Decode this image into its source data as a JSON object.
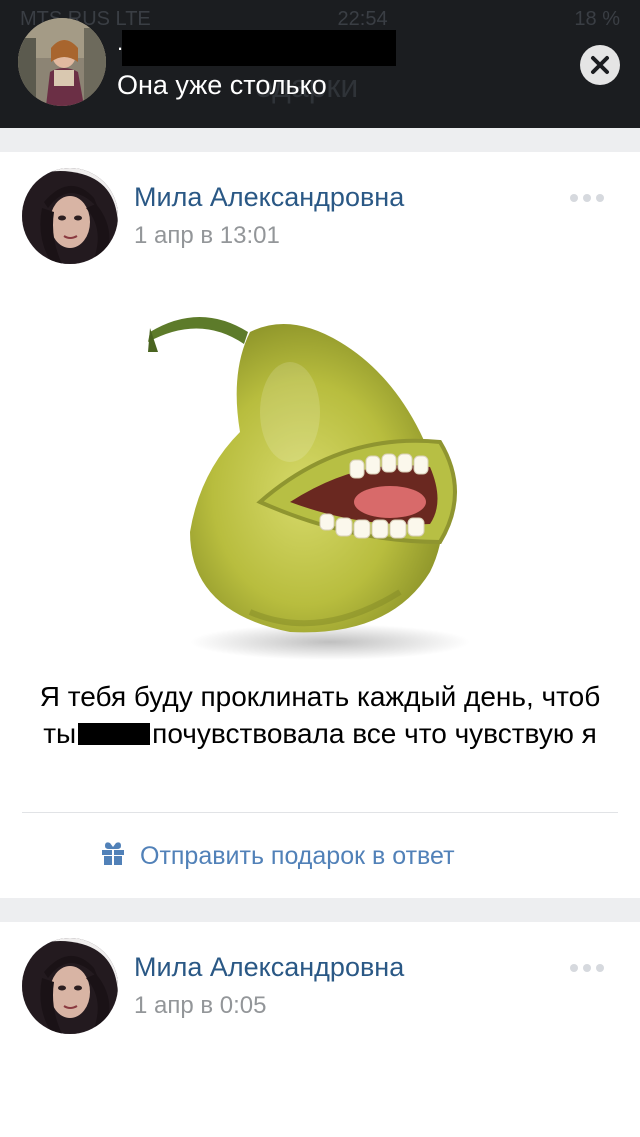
{
  "notification": {
    "sender": ".",
    "message": "Она уже столько",
    "ghost_status": {
      "carrier": "MTS RUS LTE",
      "time": "22:54",
      "battery": "18 %"
    },
    "ghost_title": "одарки",
    "close_icon": "close-icon"
  },
  "posts": [
    {
      "author": "Мила Александровна",
      "date": "1 апр в 13:01",
      "message_part1": "Я тебя буду проклинать каждый день, чтоб ты",
      "message_part2": "почувствовала все что чувствую я",
      "reply_label": "Отправить подарок в ответ",
      "reply_icon": "gift-icon"
    },
    {
      "author": "Мила Александровна",
      "date": "1 апр в 0:05"
    }
  ],
  "colors": {
    "link": "#2a5885",
    "accent": "#5181b8",
    "muted": "#939699",
    "banner": "#1b1d20"
  }
}
